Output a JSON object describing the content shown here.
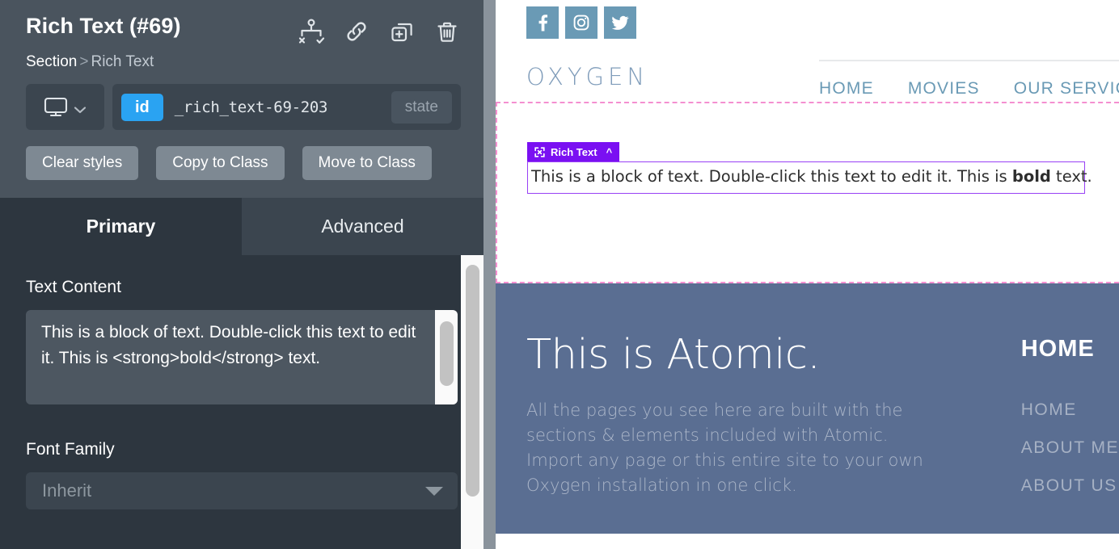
{
  "builder": {
    "element_title": "Rich Text (#69)",
    "header_icons": [
      {
        "name": "structure-icon",
        "label": "Structure"
      },
      {
        "name": "link-icon",
        "label": "Link"
      },
      {
        "name": "duplicate-icon",
        "label": "Duplicate"
      },
      {
        "name": "trash-icon",
        "label": "Delete"
      }
    ],
    "breadcrumb": {
      "root": "Section",
      "separator": ">",
      "leaf": "Rich Text"
    },
    "selector": {
      "device": "desktop",
      "id_badge": "id",
      "id_value": "_rich_text-69-203",
      "state_label": "state"
    },
    "style_buttons": [
      "Clear styles",
      "Copy to Class",
      "Move to Class"
    ],
    "tabs": [
      {
        "label": "Primary",
        "active": true
      },
      {
        "label": "Advanced",
        "active": false
      }
    ],
    "fields": {
      "text_content": {
        "label": "Text Content",
        "value": "This is a block of text. Double-click this text to edit it. This is <strong>bold</strong> text."
      },
      "font_family": {
        "label": "Font Family",
        "value": "Inherit"
      }
    },
    "colors": {
      "panel_header_bg": "#4a545e",
      "panel_body_bg": "#2d363f",
      "id_badge_bg": "#2aa3f2",
      "style_button_bg": "#7e8993",
      "divider": "#8a939c"
    }
  },
  "preview": {
    "social_links": [
      {
        "name": "facebook-icon",
        "label": "Facebook"
      },
      {
        "name": "instagram-icon",
        "label": "Instagram"
      },
      {
        "name": "twitter-icon",
        "label": "Twitter"
      }
    ],
    "brand": "OXYGEN",
    "nav_items": [
      "HOME",
      "MOVIES",
      "OUR SERVICES"
    ],
    "rich_text_element": {
      "badge_label": "Rich Text",
      "text_before_bold": "This is a block of text. Double-click this text to edit it. This is ",
      "bold_text": "bold",
      "text_after_bold": " text."
    },
    "hero": {
      "title": "This is Atomic.",
      "body": "All the pages you see here are built with the sections & elements included with Atomic. Import any page or this entire site to your own Oxygen installation in one click.",
      "side_title": "HOME",
      "side_links": [
        "HOME",
        "ABOUT ME",
        "ABOUT US"
      ]
    },
    "colors": {
      "social_bg": "#6a9ab5",
      "brand_color": "#7f9cba",
      "nav_color": "#6a9ab5",
      "section_outline": "#f48fd0",
      "element_badge_bg": "#7a10f2",
      "hero_bg": "#5a6e92"
    }
  }
}
